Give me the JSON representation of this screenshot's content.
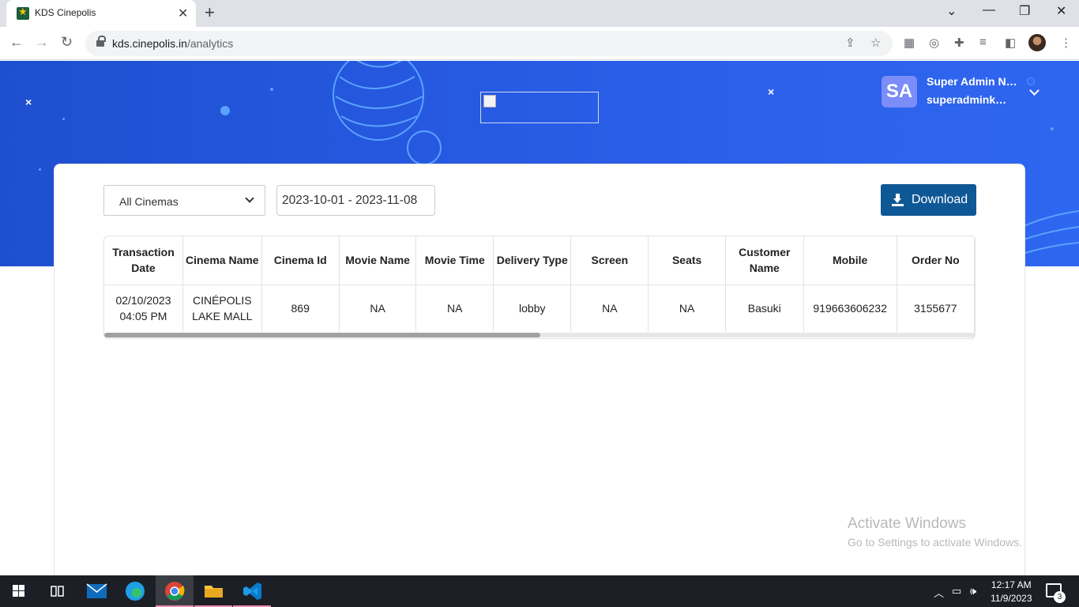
{
  "browser": {
    "tab_title": "KDS Cinepolis",
    "url_host": "kds.cinepolis.in",
    "url_path": "/analytics"
  },
  "header": {
    "avatar_initials": "SA",
    "user_name": "Super Admin Name",
    "user_email": "superadminkds@cinepolis.in"
  },
  "filters": {
    "cinema_selected": "All Cinemas",
    "date_range": "2023-10-01 - 2023-11-08",
    "download_label": "Download"
  },
  "table": {
    "headers": [
      "Transaction Date",
      "Cinema Name",
      "Cinema Id",
      "Movie Name",
      "Movie Time",
      "Delivery Type",
      "Screen",
      "Seats",
      "Customer Name",
      "Mobile",
      "Order No"
    ],
    "rows": [
      [
        "02/10/2023 04:05 PM",
        "CINÉPOLIS LAKE MALL",
        "869",
        "NA",
        "NA",
        "lobby",
        "NA",
        "NA",
        "Basuki",
        "919663606232",
        "3155677"
      ]
    ]
  },
  "watermark": {
    "line1": "Activate Windows",
    "line2": "Go to Settings to activate Windows."
  },
  "taskbar": {
    "time": "12:17 AM",
    "date": "11/9/2023",
    "notification_count": "3"
  },
  "colors": {
    "header_blue": "#2a5ee8",
    "download_button": "#0f5896",
    "avatar_bg": "#7c8cf8"
  }
}
